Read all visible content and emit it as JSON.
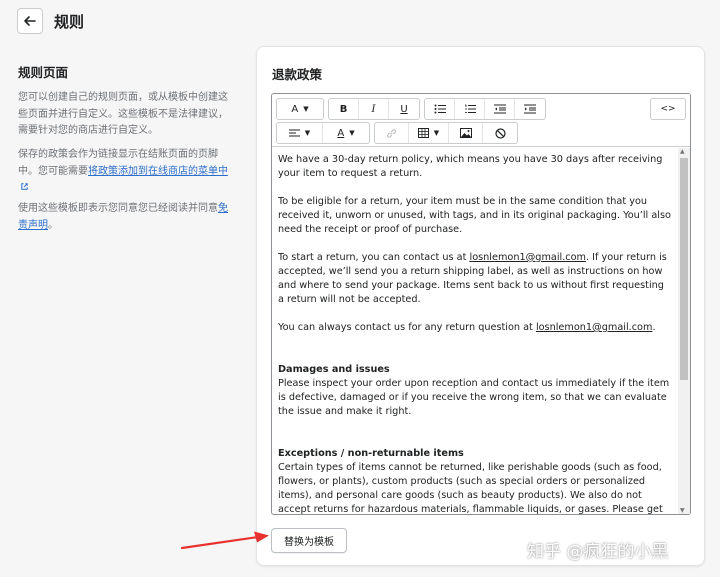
{
  "header": {
    "title": "规则",
    "back_icon": "arrow-left-icon"
  },
  "sidebar": {
    "title": "规则页面",
    "p1": "您可以创建自己的规则页面，或从模板中创建这些页面并进行自定义。这些模板不是法律建议，需要针对您的商店进行自定义。",
    "p2_text": "保存的政策会作为链接显示在结账页面的页脚中。您可能需要",
    "p2_link": "将政策添加到在线商店的菜单中",
    "p3_text": "使用这些模板即表示您同意您已经阅读并同意",
    "p3_link": "免责声明",
    "p3_end": "。"
  },
  "card": {
    "title": "退款政策",
    "replace_button": "替换为模板"
  },
  "toolbar": {
    "font_label": "A",
    "bold_label": "B",
    "italic_label": "I",
    "underline_label": "U",
    "code_label": "<>",
    "color_label": "A"
  },
  "content": {
    "p1": "We have a 30-day return policy, which means you have 30 days after receiving your item to request a return.",
    "p2": "To be eligible for a return, your item must be in the same condition that you received it, unworn or unused, with tags, and in its original packaging. You’ll also need the receipt or proof of purchase.",
    "p3_a": "To start a return, you can contact us at ",
    "email": "losnlemon1@gmail.com",
    "p3_b": ". If your return is accepted, we’ll send you a return shipping label, as well as instructions on how and where to send your package. Items sent back to us without first requesting a return will not be accepted.",
    "p4_a": "You can always contact us for any return question at ",
    "p4_b": ".",
    "h1": "Damages and issues",
    "p5": "Please inspect your order upon reception and contact us immediately if the item is defective, damaged or if you receive the wrong item, so that we can evaluate the issue and make it right.",
    "h2": "Exceptions / non-returnable items",
    "p6": "Certain types of items cannot be returned, like perishable goods (such as food, flowers, or plants), custom products (such as special orders or personalized items), and personal care goods (such as beauty products). We also do not accept returns for hazardous materials, flammable liquids, or gases. Please get in touch if you have questions or concerns about your specific item."
  },
  "watermark": "知乎 @疯狂的小黑",
  "colors": {
    "link": "#2c6ecb",
    "background": "#f6f6f7",
    "arrow": "#e8322f"
  }
}
